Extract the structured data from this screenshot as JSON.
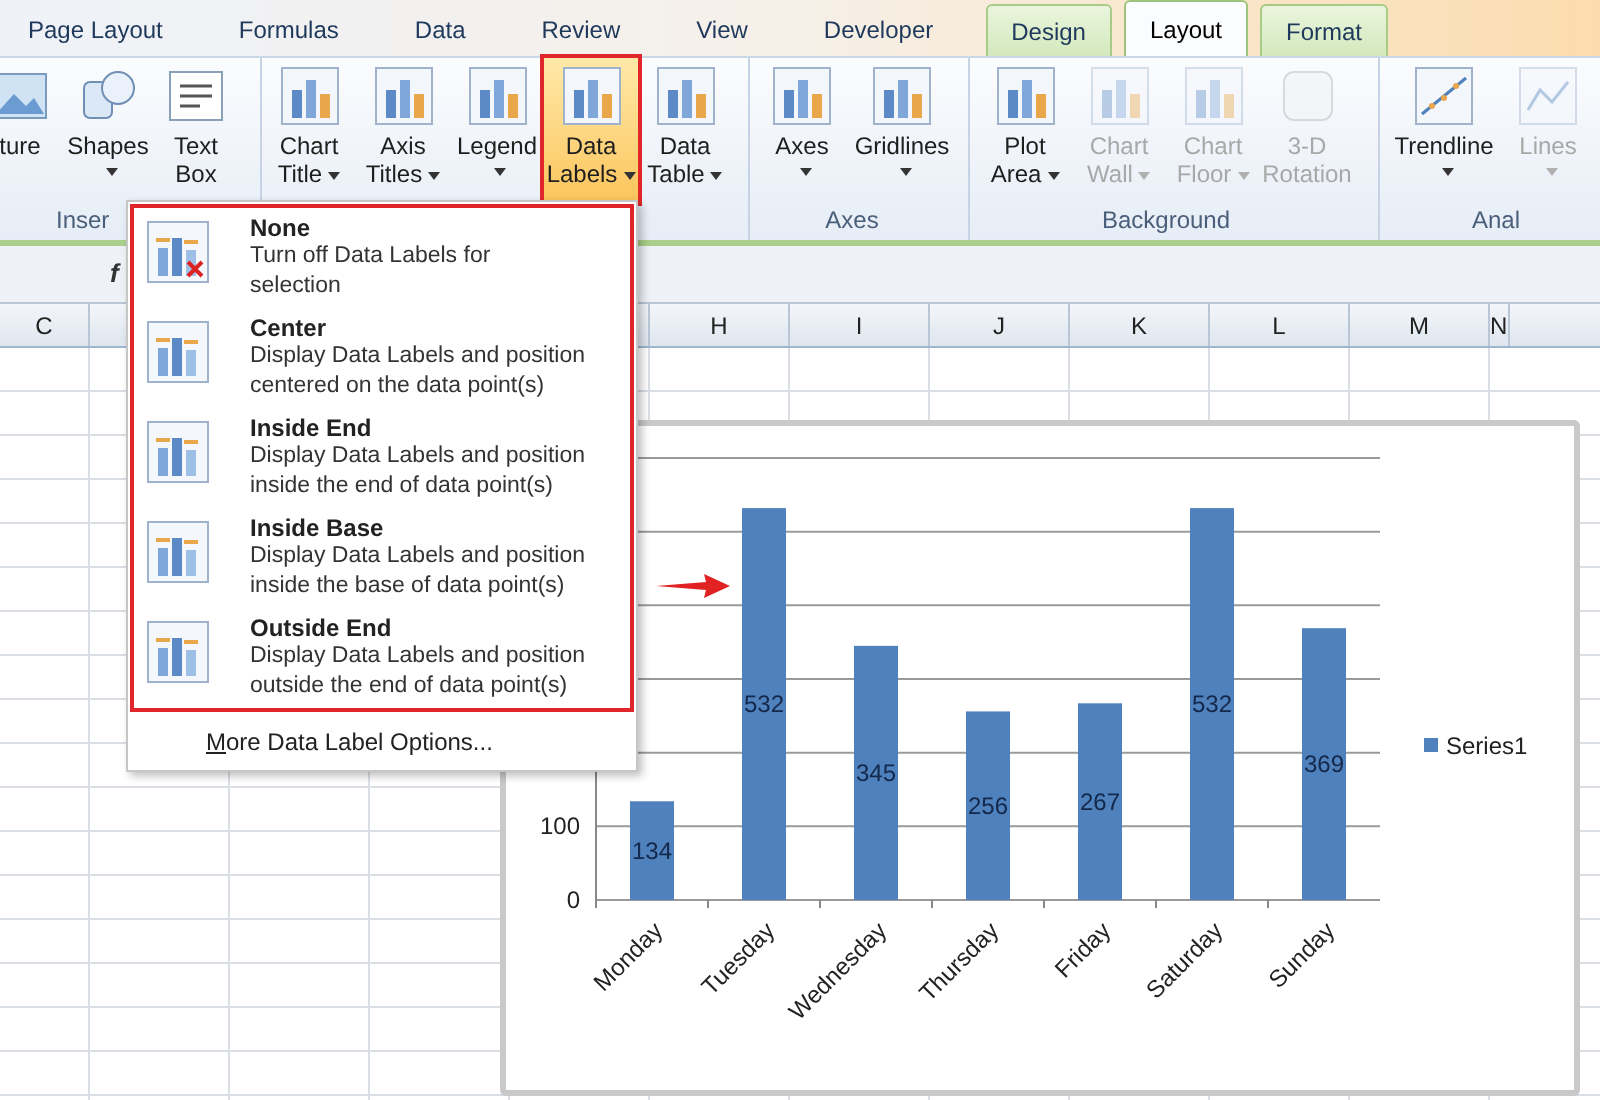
{
  "tabs": [
    {
      "label": "Page Layout",
      "kind": "normal",
      "selected": false
    },
    {
      "label": "Formulas",
      "kind": "normal",
      "selected": false
    },
    {
      "label": "Data",
      "kind": "normal",
      "selected": false
    },
    {
      "label": "Review",
      "kind": "normal",
      "selected": false
    },
    {
      "label": "View",
      "kind": "normal",
      "selected": false
    },
    {
      "label": "Developer",
      "kind": "normal",
      "selected": false
    },
    {
      "label": "Design",
      "kind": "contextual",
      "selected": false
    },
    {
      "label": "Layout",
      "kind": "contextual",
      "selected": true
    },
    {
      "label": "Format",
      "kind": "contextual",
      "selected": false
    }
  ],
  "ribbon": {
    "groups": [
      {
        "label": "Inser",
        "buttons": [
          {
            "label": "ture",
            "kind": "image",
            "dropdown": false,
            "disabled": false,
            "open": false
          },
          {
            "label": "Shapes",
            "kind": "shapes",
            "dropdown": true,
            "disabled": false,
            "open": false
          },
          {
            "label": "Text\nBox",
            "kind": "textbox",
            "dropdown": false,
            "disabled": false,
            "open": false
          }
        ]
      },
      {
        "buttons": [
          {
            "label": "Chart\nTitle",
            "kind": "chart",
            "dropdown": true,
            "disabled": false,
            "open": false
          },
          {
            "label": "Axis\nTitles",
            "kind": "chart",
            "dropdown": true,
            "disabled": false,
            "open": false
          },
          {
            "label": "Legend",
            "kind": "chart",
            "dropdown": true,
            "disabled": false,
            "open": false
          },
          {
            "label": "Data\nLabels",
            "kind": "chart",
            "dropdown": true,
            "disabled": false,
            "open": true
          },
          {
            "label": "Data\nTable",
            "kind": "chart",
            "dropdown": true,
            "disabled": false,
            "open": false
          }
        ]
      },
      {
        "label": "Axes",
        "buttons": [
          {
            "label": "Axes",
            "kind": "chart",
            "dropdown": true,
            "disabled": false,
            "open": false
          },
          {
            "label": "Gridlines",
            "kind": "chart",
            "dropdown": true,
            "disabled": false,
            "open": false
          }
        ]
      },
      {
        "label": "Background",
        "buttons": [
          {
            "label": "Plot\nArea",
            "kind": "chart",
            "dropdown": true,
            "disabled": false,
            "open": false
          },
          {
            "label": "Chart\nWall",
            "kind": "chart",
            "dropdown": true,
            "disabled": true,
            "open": false
          },
          {
            "label": "Chart\nFloor",
            "kind": "chart",
            "dropdown": true,
            "disabled": true,
            "open": false
          },
          {
            "label": "3-D\nRotation",
            "kind": "cube",
            "dropdown": false,
            "disabled": true,
            "open": false
          }
        ]
      },
      {
        "label": "Anal",
        "buttons": [
          {
            "label": "Trendline",
            "kind": "trendline",
            "dropdown": true,
            "disabled": false,
            "open": false
          },
          {
            "label": "Lines",
            "kind": "lines",
            "dropdown": true,
            "disabled": true,
            "open": false
          }
        ]
      }
    ]
  },
  "formula_bar": {
    "function_label": "f"
  },
  "sheet": {
    "column_headers": [
      "C",
      "H",
      "I",
      "J",
      "K",
      "L",
      "M",
      "N"
    ]
  },
  "menu": {
    "items": [
      {
        "title": "None",
        "description": "Turn off Data Labels for\nselection",
        "kind": "remove"
      },
      {
        "title": "Center",
        "description": "Display Data Labels and position\ncentered on the data point(s)",
        "kind": "labels"
      },
      {
        "title": "Inside End",
        "description": "Display Data Labels and position\ninside the end of data point(s)",
        "kind": "labels"
      },
      {
        "title": "Inside Base",
        "description": "Display Data Labels and position\ninside the base of data point(s)",
        "kind": "labels"
      },
      {
        "title": "Outside End",
        "description": "Display Data Labels and position\noutside the end of data point(s)",
        "kind": "labels"
      }
    ],
    "footer": "More Data Label Options..."
  },
  "chart": {
    "chart_data": {
      "type": "bar",
      "categories": [
        "Monday",
        "Tuesday",
        "Wednesday",
        "Thursday",
        "Friday",
        "Saturday",
        "Sunday"
      ],
      "series": [
        {
          "name": "Series1",
          "color": "#4f81bd",
          "values": [
            134,
            532,
            345,
            256,
            267,
            532,
            369
          ]
        }
      ],
      "ylim": [
        0,
        600
      ],
      "yticks": [
        0,
        100
      ],
      "data_labels": true
    }
  }
}
